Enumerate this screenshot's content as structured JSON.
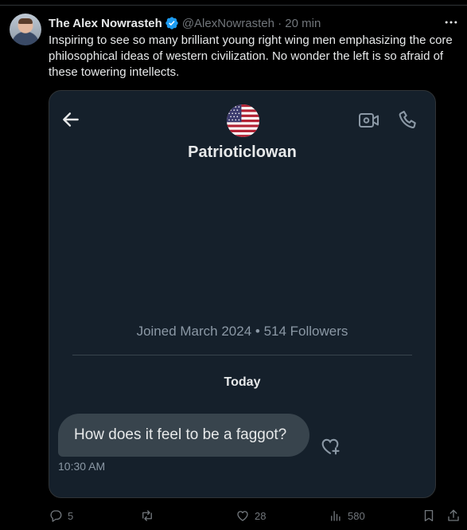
{
  "tweet": {
    "author_name": "The Alex Nowrasteh",
    "handle_time": "@AlexNowrasteh · 20 min",
    "text": "Inspiring to see so many brilliant young right wing men emphasizing the core philosophical ideas of western civilization. No wonder the left is so afraid of these towering intellects."
  },
  "dm_screenshot": {
    "contact_name": "Patrioticlowan",
    "profile_meta": "Joined March 2024 • 514 Followers",
    "day_label": "Today",
    "message_text": "How does it feel to be a faggot?",
    "message_time": "10:30 AM"
  },
  "actions": {
    "replies": "5",
    "likes": "28",
    "views": "580"
  },
  "icons": {
    "verified": "verified-badge-icon",
    "more": "more-dots-icon",
    "back": "back-arrow-icon",
    "video": "video-call-icon",
    "phone": "phone-icon",
    "reaction": "add-reaction-icon",
    "reply": "reply-icon",
    "repost": "repost-icon",
    "like": "like-icon",
    "views": "views-icon",
    "bookmark": "bookmark-icon",
    "share": "share-icon"
  },
  "colors": {
    "background": "#000000",
    "card_background": "#15202b",
    "bubble": "#38444d",
    "muted_text": "#71767b",
    "verified_blue": "#1d9bf0"
  }
}
